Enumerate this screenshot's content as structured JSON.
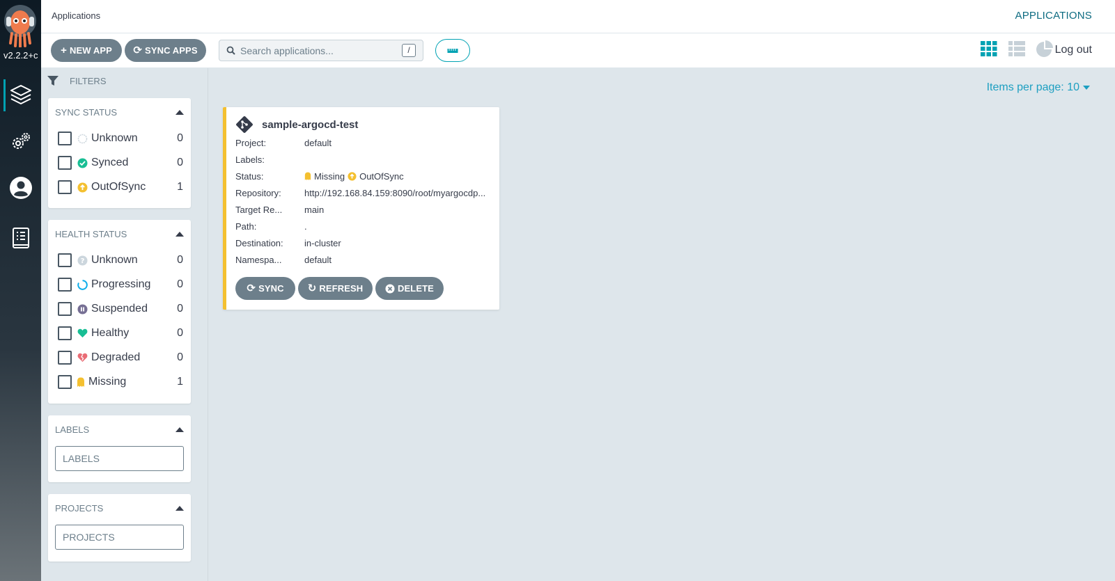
{
  "nav": {
    "version": "v2.2.2+c",
    "items": [
      "applications-icon",
      "settings-icon",
      "user-info-icon",
      "docs-icon"
    ]
  },
  "topbar": {
    "breadcrumb": "Applications",
    "page_name": "APPLICATIONS"
  },
  "toolbar": {
    "new_app": "NEW APP",
    "sync_apps": "SYNC APPS",
    "search_placeholder": "Search applications...",
    "search_shortcut": "/",
    "logout": "Log out"
  },
  "filters": {
    "title": "FILTERS",
    "sync_status": {
      "title": "SYNC STATUS",
      "options": [
        {
          "label": "Unknown",
          "count": "0"
        },
        {
          "label": "Synced",
          "count": "0"
        },
        {
          "label": "OutOfSync",
          "count": "1"
        }
      ]
    },
    "health_status": {
      "title": "HEALTH STATUS",
      "options": [
        {
          "label": "Unknown",
          "count": "0"
        },
        {
          "label": "Progressing",
          "count": "0"
        },
        {
          "label": "Suspended",
          "count": "0"
        },
        {
          "label": "Healthy",
          "count": "0"
        },
        {
          "label": "Degraded",
          "count": "0"
        },
        {
          "label": "Missing",
          "count": "1"
        }
      ]
    },
    "labels": {
      "title": "LABELS",
      "placeholder": "LABELS"
    },
    "projects": {
      "title": "PROJECTS",
      "placeholder": "PROJECTS"
    }
  },
  "content": {
    "items_per_page": "Items per page: 10"
  },
  "app": {
    "name": "sample-argocd-test",
    "fields": [
      {
        "key": "Project:",
        "value": "default"
      },
      {
        "key": "Labels:",
        "value": ""
      },
      {
        "key": "Status:",
        "value": ""
      },
      {
        "key": "Repository:",
        "value": "http://192.168.84.159:8090/root/myargocdp..."
      },
      {
        "key": "Target Re...",
        "value": "main"
      },
      {
        "key": "Path:",
        "value": "."
      },
      {
        "key": "Destination:",
        "value": "in-cluster"
      },
      {
        "key": "Namespa...",
        "value": "default"
      }
    ],
    "health": "Missing",
    "sync": "OutOfSync",
    "buttons": {
      "sync": "SYNC",
      "refresh": "REFRESH",
      "delete": "DELETE"
    }
  },
  "colors": {
    "accent": "#00a2b3",
    "button": "#6d7f8b",
    "missing": "#f4c030",
    "synced": "#18be94",
    "healthy": "#18be94",
    "degraded": "#e96d76",
    "suspended": "#766f94"
  }
}
